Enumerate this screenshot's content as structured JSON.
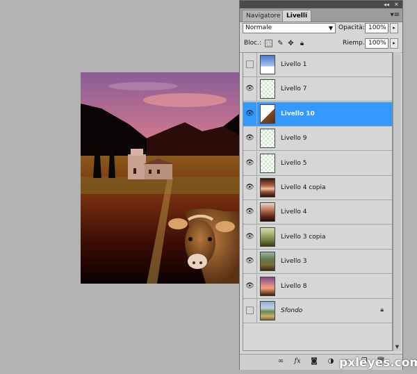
{
  "panel": {
    "tabs": [
      {
        "label": "Navigatore",
        "active": false
      },
      {
        "label": "Livelli",
        "active": true
      }
    ],
    "blend_mode": "Normale",
    "opacity_label": "Opacità:",
    "opacity_value": "100%",
    "lock_label": "Bloc.:",
    "fill_label": "Riemp.:",
    "fill_value": "100%"
  },
  "layers": [
    {
      "name": "Livello 1",
      "visible": false,
      "selected": false,
      "thumb": "sky"
    },
    {
      "name": "Livello 7",
      "visible": true,
      "selected": false,
      "thumb": "transparent-small"
    },
    {
      "name": "Livello 10",
      "visible": true,
      "selected": true,
      "thumb": "cow"
    },
    {
      "name": "Livello 9",
      "visible": true,
      "selected": false,
      "thumb": "transparent"
    },
    {
      "name": "Livello 5",
      "visible": true,
      "selected": false,
      "thumb": "transparent-small"
    },
    {
      "name": "Livello 4 copia",
      "visible": true,
      "selected": false,
      "thumb": "copper"
    },
    {
      "name": "Livello 4",
      "visible": true,
      "selected": false,
      "thumb": "copper-mountain"
    },
    {
      "name": "Livello 3 copia",
      "visible": true,
      "selected": false,
      "thumb": "field"
    },
    {
      "name": "Livello 3",
      "visible": true,
      "selected": false,
      "thumb": "field-dark"
    },
    {
      "name": "Livello 8",
      "visible": true,
      "selected": false,
      "thumb": "sunset"
    },
    {
      "name": "Sfondo",
      "visible": false,
      "selected": false,
      "thumb": "landscape",
      "italic": true,
      "locked": true
    }
  ],
  "watermark": "pxleyes.com",
  "colors": {
    "selection": "#3399ff",
    "workspace": "#b3b3b3"
  }
}
